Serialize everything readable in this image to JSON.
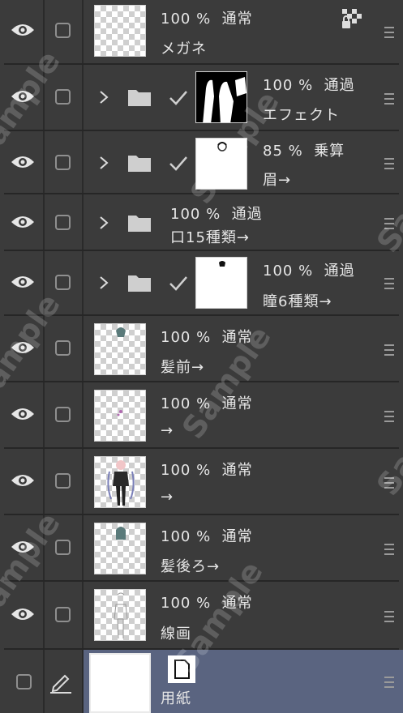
{
  "layers": [
    {
      "opacity": "100 %",
      "blend": "通常",
      "name": "メガネ",
      "visible": true,
      "folder": false,
      "clip": false,
      "thumb": "checker",
      "lock": true
    },
    {
      "opacity": "100 %",
      "blend": "通過",
      "name": "エフェクト",
      "visible": true,
      "folder": true,
      "clip": true,
      "thumb": "black"
    },
    {
      "opacity": "85 %",
      "blend": "乗算",
      "name": "眉→",
      "visible": true,
      "folder": true,
      "clip": true,
      "thumb": "white"
    },
    {
      "opacity": "100 %",
      "blend": "通過",
      "name": "口15種類→",
      "visible": true,
      "folder": true,
      "clip": false,
      "thumb": "none"
    },
    {
      "opacity": "100 %",
      "blend": "通過",
      "name": "瞳6種類→",
      "visible": true,
      "folder": true,
      "clip": true,
      "thumb": "white"
    },
    {
      "opacity": "100 %",
      "blend": "通常",
      "name": "髪前→",
      "visible": true,
      "folder": false,
      "clip": false,
      "thumb": "checker"
    },
    {
      "opacity": "100 %",
      "blend": "通常",
      "name": "→",
      "visible": true,
      "folder": false,
      "clip": false,
      "thumb": "checker"
    },
    {
      "opacity": "100 %",
      "blend": "通常",
      "name": "→",
      "visible": true,
      "folder": false,
      "clip": false,
      "thumb": "checker"
    },
    {
      "opacity": "100 %",
      "blend": "通常",
      "name": "髪後ろ→",
      "visible": true,
      "folder": false,
      "clip": false,
      "thumb": "checker"
    },
    {
      "opacity": "100 %",
      "blend": "通常",
      "name": "線画",
      "visible": true,
      "folder": false,
      "clip": false,
      "thumb": "checker"
    }
  ],
  "paper_layer": {
    "name": "用紙",
    "selected": true,
    "visible": false,
    "editing": true
  },
  "watermark": "Sample",
  "colors": {
    "panel": "#3b3b3b",
    "selected": "#5a6480",
    "divider": "#262626",
    "text": "#e6e6e6"
  }
}
